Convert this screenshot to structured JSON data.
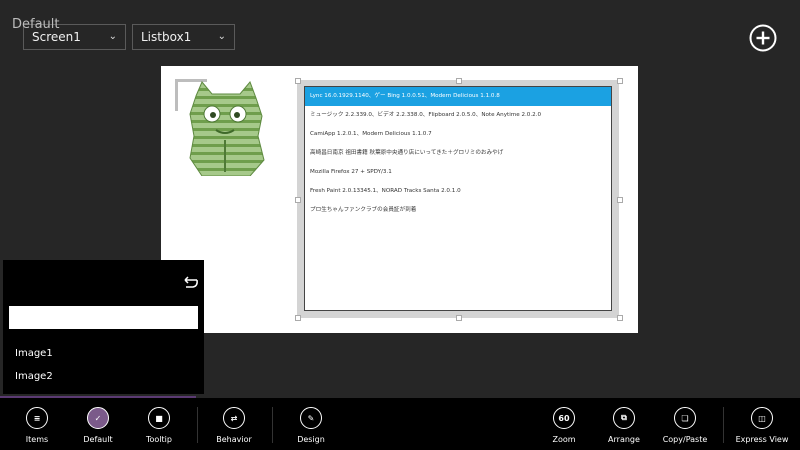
{
  "toolbar_top": {
    "screen_select": "Screen1",
    "listbox_select": "Listbox1",
    "add_icon": "plus-circle-icon"
  },
  "listbox": {
    "items": [
      "Lync 16.0.1929.1140、ゲー Bing 1.0.0.51、Modern Delicious 1.1.0.8",
      "ミュージック 2.2.339.0、ビデオ 2.2.338.0、Flipboard 2.0.5.0、Note Anytime 2.0.2.0",
      "CamiApp 1.2.0.1、Modern Delicious 1.1.0.7",
      "高崎昌日南京 祖田書籍 秋葉原中央通り店にいってきた＋グロリミのおみやげ",
      "Mozilla Firefox 27 + SPDY/3.1",
      "Fresh Paint 2.0.13345.1、NORAD Tracks Santa 2.0.1.0",
      "プロ生ちゃんファンクラブの会員証が到着"
    ],
    "selected_index": 0,
    "selected_color": "#1ba1e2"
  },
  "flyout": {
    "title": "Default",
    "input_value": "",
    "items": [
      "Image1",
      "Image2"
    ]
  },
  "bottom_bar": {
    "items": "Items",
    "default": "Default",
    "tooltip": "Tooltip",
    "behavior": "Behavior",
    "design": "Design",
    "zoom_value": "60",
    "zoom": "Zoom",
    "arrange": "Arrange",
    "copy_paste": "Copy/Paste",
    "express_view": "Express View"
  },
  "colors": {
    "background": "#262626",
    "bar": "#000000",
    "accent": "#7b5a8a"
  }
}
